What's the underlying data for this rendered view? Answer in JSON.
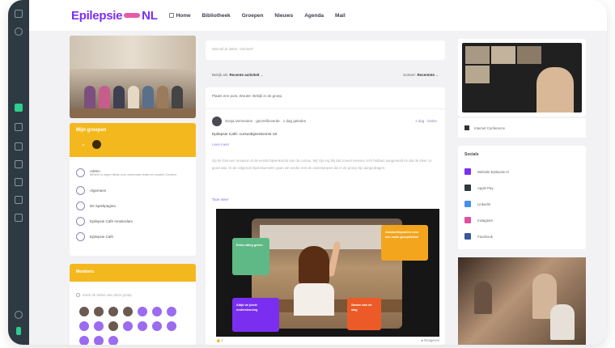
{
  "brand": {
    "name_left": "Epilepsie",
    "name_right": "NL"
  },
  "nav": {
    "items": [
      "Home",
      "Bibliotheek",
      "Groepen",
      "Nieuws",
      "Agenda",
      "Mail"
    ]
  },
  "groups": {
    "title": "Mijn groepen",
    "count_label": "3",
    "items": [
      {
        "label": "Admin",
        "sub": "Beheer in eigen fields voor verbonden leden en andere Content"
      },
      {
        "label": "Algemeen"
      },
      {
        "label": "De Spiekpagina"
      },
      {
        "label": "Epilepsie Café Amsterdam"
      },
      {
        "label": "Epilepsie Café"
      }
    ]
  },
  "members": {
    "title": "Members",
    "search_placeholder": "Zoek de leden van deze groep"
  },
  "composer": {
    "placeholder": "Wat wil je delen, Vincent?"
  },
  "filters": {
    "left_label": "Bekijk als:",
    "left_value": "Recente activiteit",
    "right_label": "Sorteer:",
    "right_value": "Recentste"
  },
  "feed": {
    "message": "Plaats een post, Wouter. Bekijk in de groep.",
    "post": {
      "author": "Sonja Vermeulen · gecertificeerde · 1 dag geleden",
      "meta": "1 dag · Delen",
      "title": "Epilepsie Café: cursusbijeenkomst 18",
      "link": "Lees meer",
      "body": "Op de foto een moment uit de eerste bijeenkomst van de cursus. Wij zijn erg blij dat zoveel mensen zich hebben aangemeld en dat de sfeer zo goed was. In de volgende bijeenkomsten gaan we verder met de onderwerpen die in de groep zijn aangedragen.",
      "more": "Toon meer"
    },
    "media_tags": {
      "green": "Extra uitleg geven",
      "yellow": "Aandachtspunten voor een vaste groepsleider",
      "purple": "Altijd de juiste ondersteuning",
      "orange": "Samen aan de slag"
    },
    "reactions": {
      "likes": "1",
      "comments_label": "Reageren"
    }
  },
  "video": {
    "caption": "Internet Conference"
  },
  "social": {
    "title": "Socials",
    "items": [
      {
        "label": "Website Epilepsie.nl",
        "color": "#7a2ff0"
      },
      {
        "label": "Apple Pay",
        "color": "#2e3a42"
      },
      {
        "label": "LinkedIn",
        "color": "#4a90e2"
      },
      {
        "label": "Instagram",
        "color": "#e04fa0"
      },
      {
        "label": "Facebook",
        "color": "#3b5998"
      }
    ]
  },
  "colors": {
    "accent": "#7b2ff7",
    "yellow": "#f4b81f",
    "rail": "#2e3a42",
    "green": "#2ecc8f"
  }
}
